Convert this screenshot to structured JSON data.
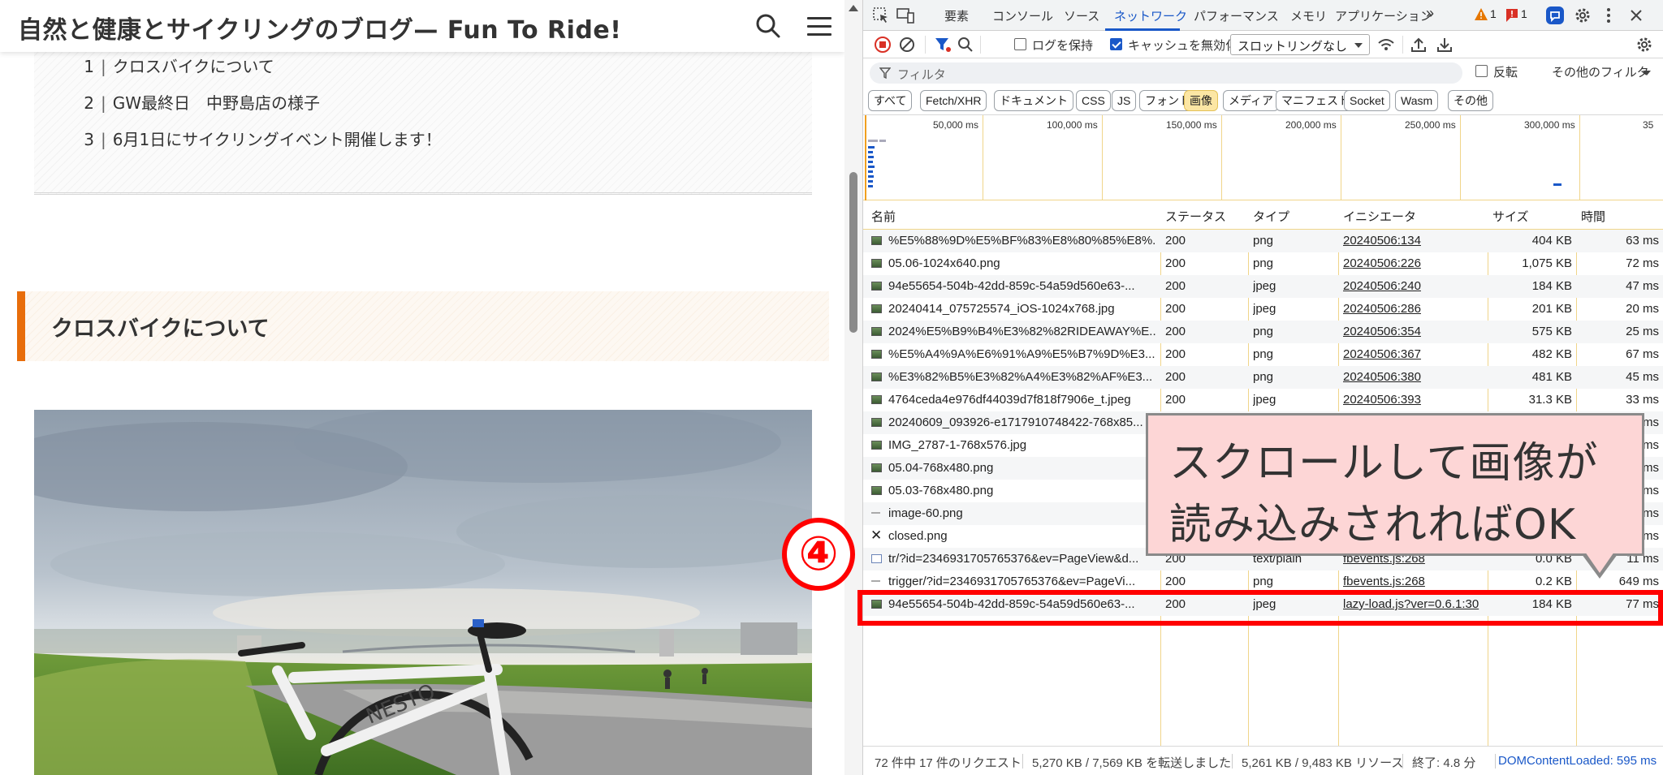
{
  "blog": {
    "site_title": "自然と健康とサイクリングのブログ— Fun To Ride!",
    "toc": [
      {
        "num": "1",
        "label": "クロスバイクについて"
      },
      {
        "num": "2",
        "label": "GW最終日　中野島店の様子"
      },
      {
        "num": "3",
        "label": "6月1日にサイクリングイベント開催します！"
      }
    ],
    "section_heading": "クロスバイクについて",
    "bike_brand": "NESTO"
  },
  "devtools": {
    "tabs": [
      "要素",
      "コンソール",
      "ソース",
      "ネットワーク",
      "パフォーマンス",
      "メモリ",
      "アプリケーション"
    ],
    "active_tab": "ネットワーク",
    "more_tabs": "»",
    "warn_count": "1",
    "issue_count": "1",
    "toolbar": {
      "preserve_log": "ログを保持",
      "disable_cache": "キャッシュを無効化",
      "throttling": "スロットリングなし"
    },
    "filter": {
      "placeholder": "フィルタ",
      "invert": "反転",
      "more_filters": "その他のフィルタ"
    },
    "type_filters": [
      "すべて",
      "Fetch/XHR",
      "ドキュメント",
      "CSS",
      "JS",
      "フォント",
      "画像",
      "メディア",
      "マニフェスト",
      "Socket",
      "Wasm",
      "その他"
    ],
    "active_type": "画像",
    "overview_ticks": [
      "50,000 ms",
      "100,000 ms",
      "150,000 ms",
      "200,000 ms",
      "250,000 ms",
      "300,000 ms",
      "35"
    ],
    "columns": [
      "名前",
      "ステータス",
      "タイプ",
      "イニシエータ",
      "サイズ",
      "時間"
    ],
    "rows": [
      {
        "name": "%E5%88%9D%E5%BF%83%E8%80%85%E8%...",
        "status": "200",
        "type": "png",
        "initiator": "20240506:134",
        "size": "404 KB",
        "time": "63 ms"
      },
      {
        "name": "05.06-1024x640.png",
        "status": "200",
        "type": "png",
        "initiator": "20240506:226",
        "size": "1,075 KB",
        "time": "72 ms"
      },
      {
        "name": "94e55654-504b-42dd-859c-54a59d560e63-...",
        "status": "200",
        "type": "jpeg",
        "initiator": "20240506:240",
        "size": "184 KB",
        "time": "47 ms"
      },
      {
        "name": "20240414_075725574_iOS-1024x768.jpg",
        "status": "200",
        "type": "jpeg",
        "initiator": "20240506:286",
        "size": "201 KB",
        "time": "20 ms"
      },
      {
        "name": "2024%E5%B9%B4%E3%82%82RIDEAWAY%E...",
        "status": "200",
        "type": "png",
        "initiator": "20240506:354",
        "size": "575 KB",
        "time": "25 ms"
      },
      {
        "name": "%E5%A4%9A%E6%91%A9%E5%B7%9D%E3...",
        "status": "200",
        "type": "png",
        "initiator": "20240506:367",
        "size": "482 KB",
        "time": "67 ms"
      },
      {
        "name": "%E3%82%B5%E3%82%A4%E3%82%AF%E3...",
        "status": "200",
        "type": "png",
        "initiator": "20240506:380",
        "size": "481 KB",
        "time": "45 ms"
      },
      {
        "name": "4764ceda4e976df44039d7f818f7906e_t.jpeg",
        "status": "200",
        "type": "jpeg",
        "initiator": "20240506:393",
        "size": "31.3 KB",
        "time": "33 ms"
      },
      {
        "name": "20240609_093926-e1717910748422-768x85...",
        "status": "",
        "type": "",
        "initiator": "",
        "size": "",
        "time": "ms"
      },
      {
        "name": "IMG_2787-1-768x576.jpg",
        "status": "",
        "type": "",
        "initiator": "",
        "size": "",
        "time": "ms"
      },
      {
        "name": "05.04-768x480.png",
        "status": "",
        "type": "",
        "initiator": "",
        "size": "",
        "time": "ms"
      },
      {
        "name": "05.03-768x480.png",
        "status": "",
        "type": "",
        "initiator": "",
        "size": "",
        "time": "ms"
      },
      {
        "name": "image-60.png",
        "status": "",
        "type": "",
        "initiator": "",
        "size": "",
        "time": "ms"
      },
      {
        "name": "closed.png",
        "status": "",
        "type": "",
        "initiator": "",
        "size": "",
        "time": "ms"
      },
      {
        "name": "tr/?id=2346931705765376&ev=PageView&d...",
        "status": "200",
        "type": "text/plain",
        "initiator": "fbevents.js:268",
        "size": "0.0 KB",
        "time": "11 ms"
      },
      {
        "name": "trigger/?id=2346931705765376&ev=PageVi...",
        "status": "200",
        "type": "png",
        "initiator": "fbevents.js:268",
        "size": "0.2 KB",
        "time": "649 ms"
      },
      {
        "name": "94e55654-504b-42dd-859c-54a59d560e63-...",
        "status": "200",
        "type": "jpeg",
        "initiator": "lazy-load.js?ver=0.6.1:30",
        "size": "184 KB",
        "time": "77 ms"
      }
    ],
    "status_bar": {
      "requests": "72 件中 17 件のリクエスト",
      "transferred": "5,270 KB / 7,569 KB を転送しました",
      "resources": "5,261 KB / 9,483 KB リソース",
      "finish": "終了: 4.8 分",
      "dcl": "DOMContentLoaded: 595 ms"
    }
  },
  "annotation": {
    "step": "④",
    "callout_line1": "スクロールして画像が",
    "callout_line2": "読み込みされればOK",
    "highlight_color": "#ff0000"
  }
}
